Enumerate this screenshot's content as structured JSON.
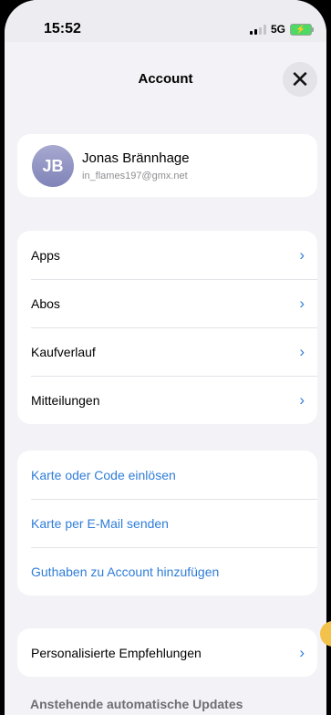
{
  "status_bar": {
    "time": "15:52",
    "network": "5G",
    "battery_icon": "battery-charging-icon",
    "signal_icon": "signal-icon"
  },
  "sheet": {
    "title": "Account",
    "close_icon": "close-icon"
  },
  "profile": {
    "initials": "JB",
    "name": "Jonas Brännhage",
    "email": "in_flames197@gmx.net"
  },
  "menu": {
    "items": [
      {
        "label": "Apps"
      },
      {
        "label": "Abos"
      },
      {
        "label": "Kaufverlauf"
      },
      {
        "label": "Mitteilungen"
      }
    ]
  },
  "gift_actions": {
    "items": [
      {
        "label": "Karte oder Code einlösen"
      },
      {
        "label": "Karte per E-Mail senden"
      },
      {
        "label": "Guthaben zu Account hinzufügen"
      }
    ]
  },
  "recommendations": {
    "label": "Personalisierte Empfehlungen"
  },
  "updates": {
    "section_title": "Anstehende automatische Updates"
  },
  "colors": {
    "accent": "#2f7dd8",
    "background": "#f2f2f7",
    "battery": "#4cd964"
  }
}
